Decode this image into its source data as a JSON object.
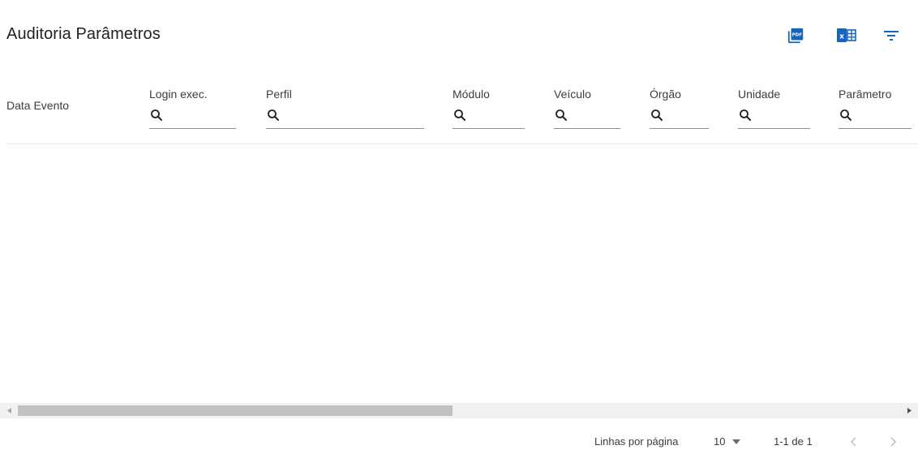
{
  "header": {
    "title": "Auditoria Parâmetros",
    "actions": [
      {
        "icon": "pdf-icon",
        "color": "#1565c0"
      },
      {
        "icon": "excel-icon",
        "color": "#1565c0"
      },
      {
        "icon": "filter-icon",
        "color": "#1565c0"
      }
    ]
  },
  "table": {
    "columns": [
      {
        "label": "Data Evento",
        "filterable": false
      },
      {
        "label": "Login exec.",
        "filterable": true
      },
      {
        "label": "Perfil",
        "filterable": true
      },
      {
        "label": "Módulo",
        "filterable": true
      },
      {
        "label": "Veículo",
        "filterable": true
      },
      {
        "label": "Órgão",
        "filterable": true
      },
      {
        "label": "Unidade",
        "filterable": true
      },
      {
        "label": "Parâmetro",
        "filterable": true
      }
    ],
    "rows": []
  },
  "scrollbar": {
    "horizontal": true
  },
  "pagination": {
    "rows_per_page_label": "Linhas por página",
    "rows_per_page_value": "10",
    "range_label": "1-1 de 1"
  },
  "colors": {
    "accent": "#1565c0",
    "text": "#202124",
    "divider": "#e4e4e4"
  }
}
